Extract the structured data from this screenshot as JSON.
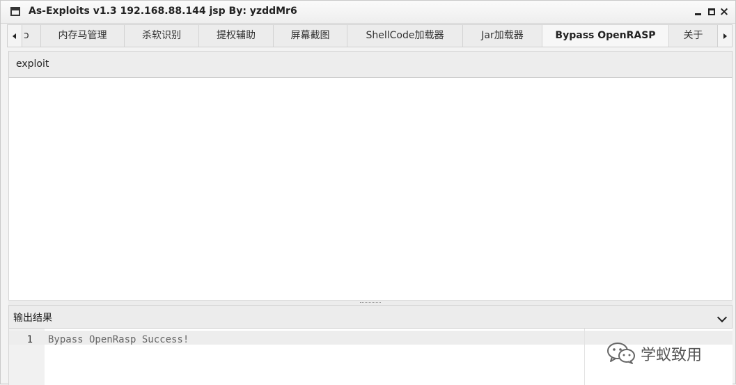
{
  "window": {
    "title": "As-Exploits v1.3 192.168.88.144 jsp By: yzddMr6",
    "controls": {
      "minimize": "minimize-icon",
      "maximize": "maximize-icon",
      "close": "×"
    }
  },
  "tabs": [
    {
      "label": "ɔ",
      "active": false
    },
    {
      "label": "内存马管理",
      "active": false
    },
    {
      "label": "杀软识别",
      "active": false
    },
    {
      "label": "提权辅助",
      "active": false
    },
    {
      "label": "屏幕截图",
      "active": false
    },
    {
      "label": "ShellCode加载器",
      "active": false
    },
    {
      "label": "Jar加载器",
      "active": false
    },
    {
      "label": "Bypass OpenRASP",
      "active": true
    },
    {
      "label": "关于",
      "active": false
    }
  ],
  "toolbar": {
    "exploit_label": "exploit"
  },
  "output": {
    "title": "输出结果",
    "lines": [
      {
        "number": "1",
        "text": "Bypass OpenRasp Success!"
      }
    ]
  },
  "watermark": {
    "text": "学蚁致用"
  },
  "colors": {
    "window_bg": "#f3f3f3",
    "active_tab_bg": "#f7f7f7",
    "output_text": "#666666"
  }
}
